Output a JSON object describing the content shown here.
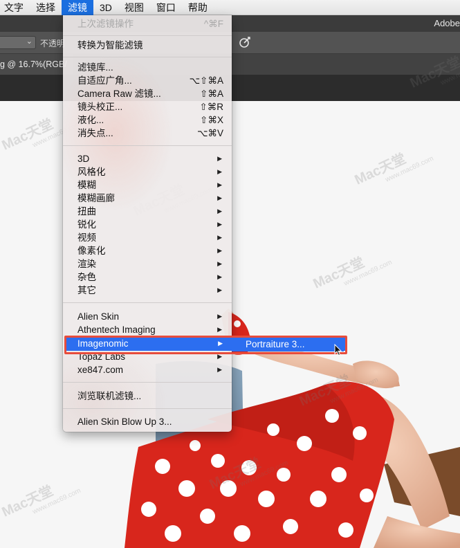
{
  "menubar": {
    "items": [
      "文字",
      "选择",
      "滤镜",
      "3D",
      "视图",
      "窗口",
      "帮助"
    ],
    "active_index": 2
  },
  "app": {
    "title": "Adobe"
  },
  "options_bar": {
    "opacity_label": "不透明"
  },
  "document": {
    "tab_label": "g @ 16.7%(RGB/"
  },
  "filter_menu": {
    "last_filter": {
      "label": "上次滤镜操作",
      "shortcut": "^⌘F"
    },
    "smart": "转换为智能滤镜",
    "gallery": [
      {
        "label": "滤镜库...",
        "shortcut": ""
      },
      {
        "label": "自适应广角...",
        "shortcut": "⌥⇧⌘A"
      },
      {
        "label": "Camera Raw 滤镜...",
        "shortcut": "⇧⌘A"
      },
      {
        "label": "镜头校正...",
        "shortcut": "⇧⌘R"
      },
      {
        "label": "液化...",
        "shortcut": "⇧⌘X"
      },
      {
        "label": "消失点...",
        "shortcut": "⌥⌘V"
      }
    ],
    "categories": [
      "3D",
      "风格化",
      "模糊",
      "模糊画廊",
      "扭曲",
      "锐化",
      "视频",
      "像素化",
      "渲染",
      "杂色",
      "其它"
    ],
    "plugins": [
      "Alien Skin",
      "Athentech Imaging",
      "Imagenomic",
      "Topaz Labs",
      "xe847.com"
    ],
    "highlighted_plugin": "Imagenomic",
    "browse": "浏览联机滤镜...",
    "blowup": "Alien Skin Blow Up 3..."
  },
  "submenu": {
    "item": "Portraiture 3..."
  },
  "watermark": {
    "text": "Mac天堂",
    "url": "www.mac69.com"
  },
  "colors": {
    "accent": "#2c6ef0",
    "highlight_border": "#e74c3c",
    "skirt_red": "#d8261c"
  }
}
